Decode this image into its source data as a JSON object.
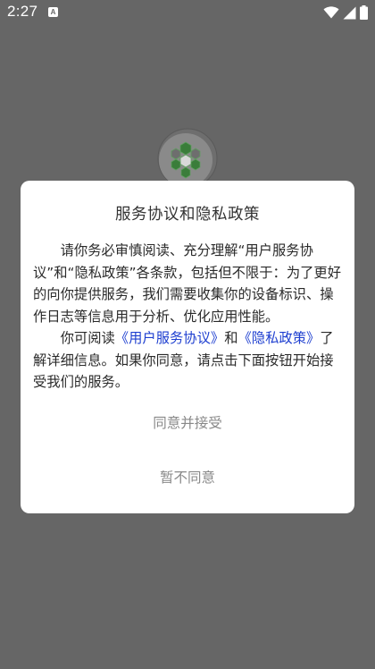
{
  "status_bar": {
    "time": "2:27",
    "notification_icon_letter": "A",
    "icons": [
      "wifi-icon",
      "signal-icon",
      "battery-icon"
    ]
  },
  "splash": {
    "logo_icon": "hexagon-cluster-logo",
    "colors": {
      "logo_green": "#3a7d3a",
      "logo_bg": "#8a8a8a"
    }
  },
  "dialog": {
    "title": "服务协议和隐私政策",
    "paragraph1": "请你务必审慎阅读、充分理解“用户服务协议”和“隐私政策”各条款，包括但不限于：为了更好的向你提供服务，我们需要收集你的设备标识、操作日志等信息用于分析、优化应用性能。",
    "paragraph2_prefix": "你可阅读",
    "user_agreement_link": "《用户服务协议》",
    "paragraph2_and": "和",
    "privacy_policy_link": "《隐私政策》",
    "paragraph2_suffix": "了解详细信息。如果你同意，请点击下面按钮开始接受我们的服务。",
    "agree_label": "同意并接受",
    "disagree_label": "暂不同意",
    "colors": {
      "link": "#1e3fd0",
      "button_text": "#888888"
    }
  }
}
